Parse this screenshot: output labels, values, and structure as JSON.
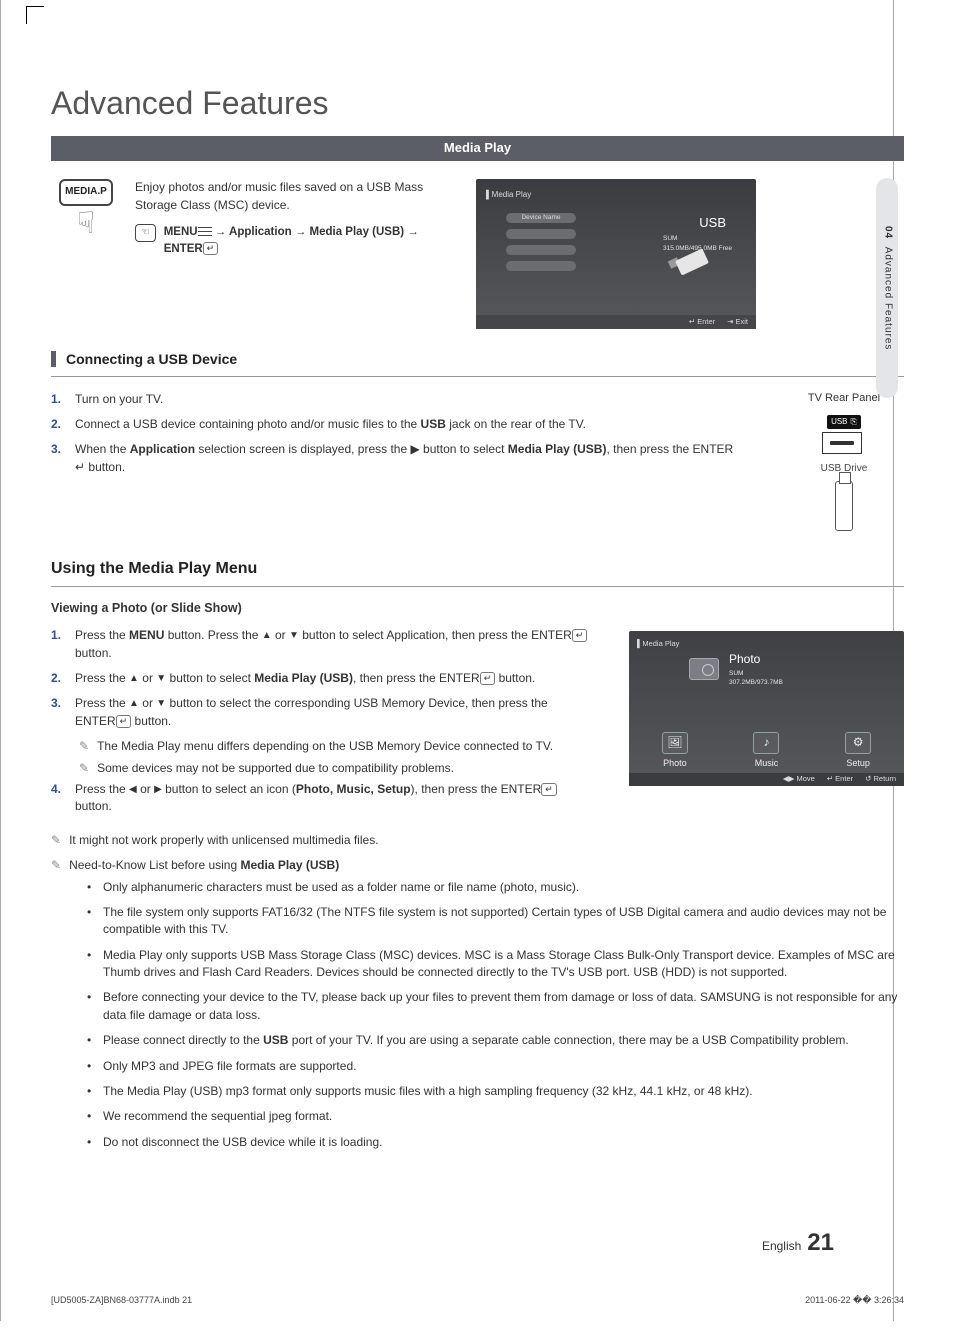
{
  "title": "Advanced Features",
  "header_bar": "Media Play",
  "side_tab": {
    "num": "04",
    "label": "Advanced Features"
  },
  "intro": {
    "mediap_label": "MEDIA.P",
    "text": "Enjoy photos and/or music files saved on a USB Mass Storage Class (MSC) device.",
    "menu_path_prefix": "MENU",
    "menu_path_rest": " → Application → Media Play (USB) → ENTER"
  },
  "intro_screen": {
    "mp_label": "Media Play",
    "device_name": "Device Name",
    "usb": "USB",
    "free_line1": "SUM",
    "free_line2": "315.0MB/495.0MB Free",
    "enter": "↵ Enter",
    "exit": "⇥ Exit"
  },
  "sect1": {
    "title": "Connecting a USB Device",
    "rear_label": "TV Rear Panel",
    "usb_tag": "USB",
    "usb_drive_label": "USB Drive",
    "steps": [
      {
        "n": "1.",
        "t": "Turn on your TV."
      },
      {
        "n": "2.",
        "t_before": "Connect a USB device containing photo and/or music files to the ",
        "t_bold": "USB",
        "t_after": " jack on the rear of the TV."
      },
      {
        "n": "3.",
        "t_before": "When the ",
        "t_bold1": "Application",
        "t_mid": " selection screen is displayed, press the ▶ button to select ",
        "t_bold2": "Media Play (USB)",
        "t_after": ", then press the ENTER ↵ button."
      }
    ]
  },
  "sect2": {
    "title": "Using the Media Play Menu",
    "subtitle": "Viewing a Photo (or Slide Show)",
    "steps": [
      {
        "n": "1.",
        "t": "Press the MENU button. Press the ▲ or ▼ button to select Application, then press the ENTER ↵ button."
      },
      {
        "n": "2.",
        "t": "Press the ▲ or ▼ button to select Media Play (USB), then press the ENTER ↵ button."
      },
      {
        "n": "3.",
        "t": "Press the ▲ or ▼ button to select the corresponding USB Memory Device, then press the ENTER ↵ button."
      },
      {
        "n": "4.",
        "t": "Press the ◀ or ▶ button to select an icon (Photo, Music, Setup), then press the ENTER ↵ button."
      }
    ],
    "step3_notes": [
      "The Media Play menu differs depending on the USB Memory Device connected to TV.",
      "Some devices may not be supported due to compatibility problems."
    ],
    "photo_screen": {
      "mp_label": "Media Play",
      "title": "Photo",
      "sub1": "SUM",
      "sub2": "307.2MB/973.7MB",
      "tab_photo": "Photo",
      "tab_music": "Music",
      "tab_setup": "Setup",
      "move": "◀▶ Move",
      "enter": "↵ Enter",
      "return": "↺ Return"
    }
  },
  "root_notes": [
    "It might not work properly with unlicensed multimedia files.",
    "Need-to-Know List before using Media Play (USB)"
  ],
  "know_bullets": [
    "Only alphanumeric characters must be used as a folder name or file name (photo, music).",
    "The file system only supports FAT16/32 (The NTFS file system is not supported) Certain types of USB Digital camera and audio devices may not be compatible with this TV.",
    "Media Play only supports USB Mass Storage Class (MSC) devices. MSC is a Mass Storage Class Bulk-Only Transport device. Examples of MSC are Thumb drives and Flash Card Readers. Devices should be connected directly to the TV's USB port. USB (HDD) is not supported.",
    "Before connecting your device to the TV, please back up your files to prevent them from damage or loss of data. SAMSUNG is not responsible for any data file damage or data loss.",
    "Please connect directly to the USB port of your TV. If you are using a separate cable connection, there may be a USB Compatibility problem.",
    "Only MP3 and JPEG file formats are supported.",
    "The Media Play (USB) mp3 format only supports music files with a high sampling frequency (32 kHz, 44.1 kHz, or 48 kHz).",
    "We recommend the sequential jpeg format.",
    "Do not disconnect the USB device while it is loading."
  ],
  "footer": {
    "lang": "English",
    "page": "21"
  },
  "print": {
    "left": "[UD5005-ZA]BN68-03777A.indb   21",
    "right": "2011-06-22   �� 3:26:34"
  }
}
